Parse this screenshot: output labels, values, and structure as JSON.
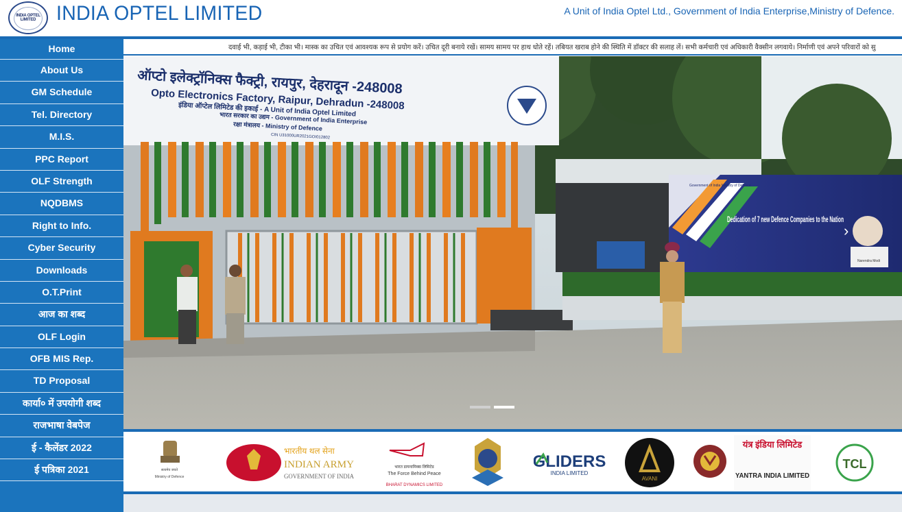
{
  "header": {
    "title": "INDIA OPTEL LIMITED",
    "tagline": "A Unit of India Optel Ltd., Government of India Enterprise,Ministry of Defence.",
    "logo_text": "INDIA OPTEL LIMITED"
  },
  "sidebar": {
    "items": [
      {
        "label": "Home"
      },
      {
        "label": "About Us"
      },
      {
        "label": "GM Schedule"
      },
      {
        "label": "Tel. Directory"
      },
      {
        "label": "M.I.S."
      },
      {
        "label": "PPC Report"
      },
      {
        "label": "OLF Strength"
      },
      {
        "label": "NQDBMS"
      },
      {
        "label": "Right to Info."
      },
      {
        "label": "Cyber Security"
      },
      {
        "label": "Downloads"
      },
      {
        "label": "O.T.Print"
      },
      {
        "label": "आज का शब्द"
      },
      {
        "label": "OLF Login"
      },
      {
        "label": "OFB MIS Rep."
      },
      {
        "label": "TD Proposal"
      },
      {
        "label": "कार्या० में उपयोगी शब्द"
      },
      {
        "label": "राजभाषा वेबपेज"
      },
      {
        "label": "ई - कैलेंडर 2022"
      },
      {
        "label": "ई पत्रिका 2021"
      }
    ]
  },
  "ticker": {
    "text": "दवाई भी, कड़ाई भी, टीका भी।   मास्क का उचित एवं आवश्यक रूप से प्रयोग करें।   उचित दूरी बनाये रखें।   सामय सामय पर हाथ धोते रहें।   तबियत खराब होने की स्थिति में डॉक्टर की सलाह लें।   सभी कर्मचारी एवं अधिकारी वैक्सीन लगवाये।   निर्माणी एवं अपने परिवारों को सु"
  },
  "slide": {
    "banner_hindi": "ऑप्टो इलेक्ट्रॉनिक्स फैक्ट्री, रायपुर, देहरादून -248008",
    "banner_english": "Opto Electronics Factory, Raipur, Dehradun -248008",
    "banner_unit_hindi": "इंडिया ऑप्टेल लिमिटेड की इकाई - A Unit of India Optel Limited",
    "banner_goi": "भारत सरकार का उद्यम - Government of India Enterprise",
    "banner_mod": "रक्षा मंत्रालय - Ministry of Defence",
    "banner_cin": "CIN U31000UR2021GOI012802",
    "poster_text": "Dedication of 7 new Defence Companies to the Nation",
    "poster_org": "Government of India Ministry of Defence",
    "poster_name": "Narendra Modi"
  },
  "partners": [
    {
      "name": "mod-logo",
      "line1": "सत्यमेव जयते",
      "line2": "Ministry of Defence"
    },
    {
      "name": "indian-army-logo",
      "line1": "भारतीय थल सेना",
      "line2": "INDIAN ARMY",
      "line3": "GOVERNMENT OF INDIA"
    },
    {
      "name": "bdl-logo",
      "line1": "भारत डायनामिक्स लिमिटेड",
      "line2": "The Force Behind Peace",
      "line3": "BHARAT DYNAMICS LIMITED"
    },
    {
      "name": "iaf-logo"
    },
    {
      "name": "gliders-logo",
      "line1": "GLIDERS",
      "line2": "INDIA LIMITED"
    },
    {
      "name": "avani-logo",
      "line1": "AVANI"
    },
    {
      "name": "munitions-logo"
    },
    {
      "name": "yantra-logo",
      "line1": "यंत्र इंडिया लिमिटेड",
      "line2": "YANTRA INDIA LIMITED"
    },
    {
      "name": "tcl-logo",
      "line1": "TCL"
    }
  ],
  "colors": {
    "brand": "#1864b4",
    "sidebar": "#1b74bd",
    "divider": "#d6e6f5"
  }
}
